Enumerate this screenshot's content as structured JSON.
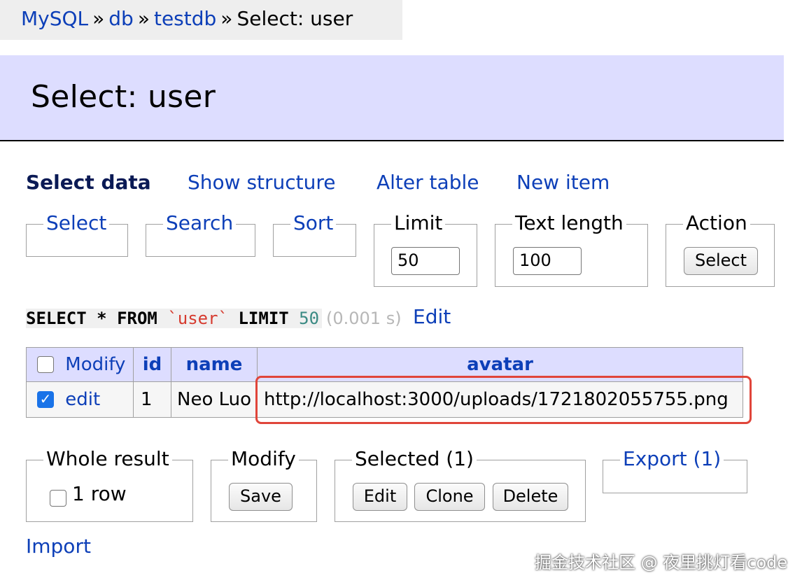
{
  "breadcrumb": {
    "items": [
      "MySQL",
      "db",
      "testdb"
    ],
    "separator": "»",
    "current": "Select: user"
  },
  "page_title": "Select: user",
  "tabs": {
    "select_data": "Select data",
    "show_structure": "Show structure",
    "alter_table": "Alter table",
    "new_item": "New item"
  },
  "filters": {
    "select": "Select",
    "search": "Search",
    "sort": "Sort",
    "limit_label": "Limit",
    "limit_value": "50",
    "text_length_label": "Text length",
    "text_length_value": "100",
    "action_label": "Action",
    "action_button": "Select"
  },
  "query": {
    "kw_select": "SELECT",
    "star": "*",
    "kw_from": "FROM",
    "table": "`user`",
    "kw_limit": "LIMIT",
    "limit": "50",
    "time": "(0.001 s)",
    "edit": "Edit"
  },
  "table": {
    "header_modify": "Modify",
    "columns": [
      "id",
      "name",
      "avatar"
    ],
    "rows": [
      {
        "edit": "edit",
        "checked": true,
        "id": "1",
        "name": "Neo Luo",
        "avatar": "http://localhost:3000/uploads/1721802055755.png"
      }
    ]
  },
  "actions": {
    "whole_result_label": "Whole result",
    "row_count": "1 row",
    "modify_label": "Modify",
    "save": "Save",
    "selected_label": "Selected (1)",
    "edit": "Edit",
    "clone": "Clone",
    "delete": "Delete",
    "export_label": "Export (1)"
  },
  "import_link": "Import",
  "watermark": "掘金技术社区 @ 夜里挑灯看code",
  "colors": {
    "link": "#0d3fb8",
    "header_bg": "#ddddff",
    "highlight": "#e0453a"
  }
}
